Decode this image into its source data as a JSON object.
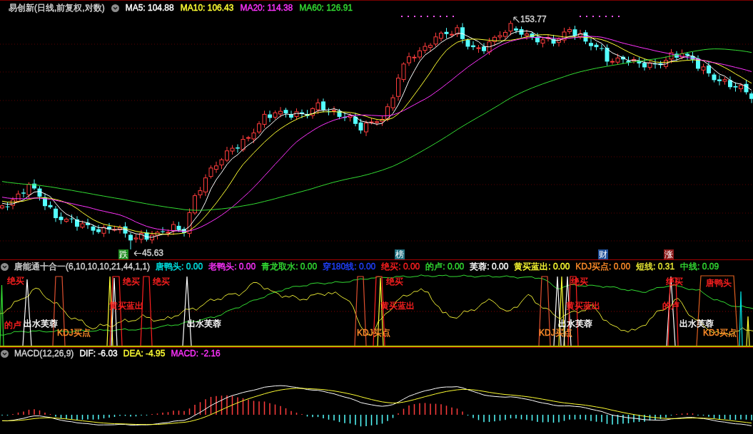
{
  "main_chart": {
    "title": "易创新(日线,前复权,对数)",
    "moving_averages": [
      {
        "label": "MA5: 104.88",
        "color": "#ffffff"
      },
      {
        "label": "MA10: 106.43",
        "color": "#ffff33"
      },
      {
        "label": "MA20: 114.38",
        "color": "#ff33ff"
      },
      {
        "label": "MA60: 126.91",
        "color": "#33dd33"
      }
    ],
    "price_labels": [
      {
        "kind": "high",
        "text": "153.77"
      },
      {
        "kind": "low",
        "text": "45.63"
      }
    ],
    "event_markers": [
      {
        "text": "跌",
        "color": "#1e8c1e"
      },
      {
        "text": "榜",
        "color": "#1f6f80"
      },
      {
        "text": "财",
        "color": "#1f4f99"
      },
      {
        "text": "涨",
        "color": "#8c1a1a"
      }
    ]
  },
  "indicator_panel": {
    "title": "唐能通十合一(6,10,10,10,21,44,1,1)",
    "readouts": [
      {
        "label": "唐鸭头: 0.00",
        "color": "#00e5e5"
      },
      {
        "label": "老鸭头: 0.00",
        "color": "#ff33ff"
      },
      {
        "label": "青龙取水: 0.00",
        "color": "#33dd33"
      },
      {
        "label": "穿180线: 0.00",
        "color": "#2040ff"
      },
      {
        "label": "绝买: 0.00",
        "color": "#ff2020"
      },
      {
        "label": "的卢: 0.00",
        "color": "#33dd33"
      },
      {
        "label": "芙蓉: 0.00",
        "color": "#ffffff"
      },
      {
        "label": "黄买蓝出: 0.00",
        "color": "#ffff33"
      },
      {
        "label": "KDJ买点: 0.00",
        "color": "#ff8c2a"
      },
      {
        "label": "短线: 0.31",
        "color": "#e6e633"
      },
      {
        "label": "中线: 0.09",
        "color": "#33dd33"
      }
    ],
    "signal_labels": [
      {
        "text": "绝买",
        "color": "#ff2020"
      },
      {
        "text": "的卢",
        "color": "#ff2020"
      },
      {
        "text": "出水芙蓉",
        "color": "#ffffff"
      },
      {
        "text": "KDJ买点",
        "color": "#ff8c2a"
      },
      {
        "text": "绝买",
        "color": "#ff2020"
      },
      {
        "text": "黄买蓝出",
        "color": "#ff2020"
      },
      {
        "text": "绝买",
        "color": "#ff2020"
      },
      {
        "text": "出水芙蓉",
        "color": "#ffffff"
      },
      {
        "text": "绝买",
        "color": "#ff2020"
      },
      {
        "text": "黄买蓝出",
        "color": "#ff2020"
      },
      {
        "text": "KDJ买点",
        "color": "#ff8c2a"
      },
      {
        "text": "绝买",
        "color": "#ff2020"
      },
      {
        "text": "黄买蓝出",
        "color": "#ff2020"
      },
      {
        "text": "出水芙蓉",
        "color": "#ffffff"
      },
      {
        "text": "KDJ买点",
        "color": "#ff8c2a"
      },
      {
        "text": "绝买",
        "color": "#ff2020"
      },
      {
        "text": "唐鸭头",
        "color": "#ff2020"
      },
      {
        "text": "的卢",
        "color": "#ff2020"
      },
      {
        "text": "出水芙蓉",
        "color": "#ffffff"
      },
      {
        "text": "KDJ买点",
        "color": "#ff8c2a"
      }
    ]
  },
  "macd_panel": {
    "title": "MACD(12,26,9)",
    "readouts": [
      {
        "label": "DIF: -6.03",
        "color": "#ffffff"
      },
      {
        "label": "DEA: -4.95",
        "color": "#ffff33"
      },
      {
        "label": "MACD: -2.16",
        "color": "#ff33ff"
      }
    ]
  }
}
